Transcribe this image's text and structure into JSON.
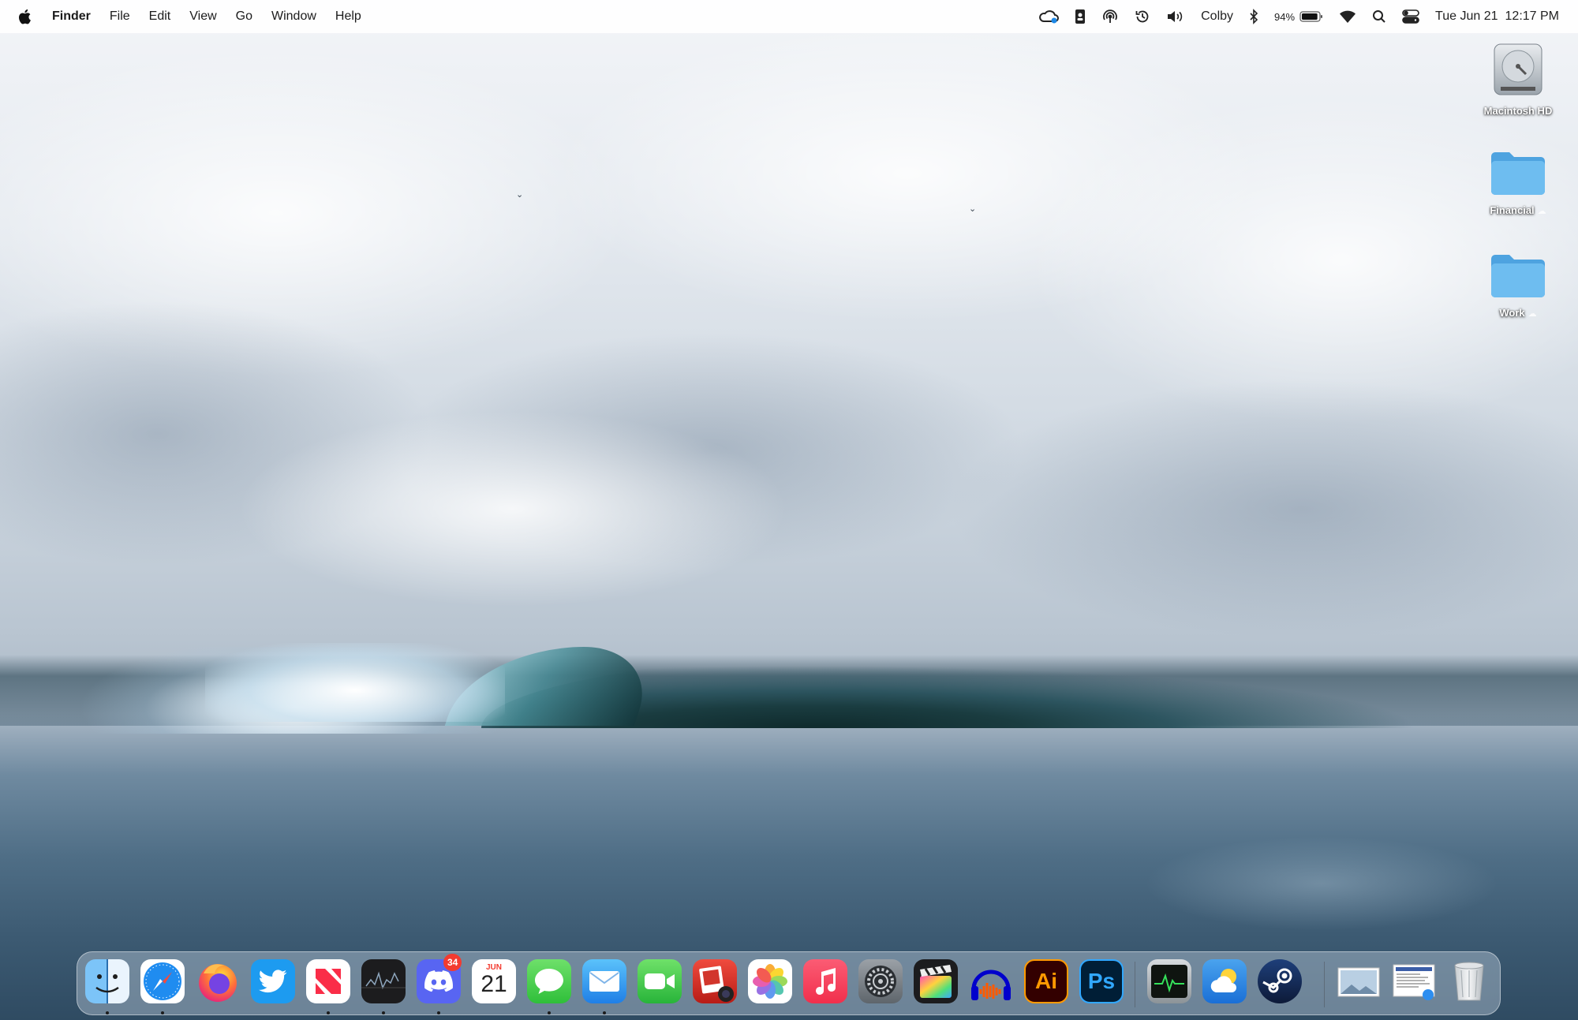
{
  "menubar": {
    "app_name": "Finder",
    "menus": [
      "File",
      "Edit",
      "View",
      "Go",
      "Window",
      "Help"
    ],
    "status": {
      "user_name": "Colby",
      "battery_percent": "94%",
      "battery_level": 0.94,
      "date": "Tue Jun 21",
      "time": "12:17 PM"
    }
  },
  "desktop": {
    "icons": [
      {
        "label": "Macintosh HD",
        "icon": "hard-drive-icon"
      },
      {
        "label": "Financial",
        "icon": "folder-icon"
      },
      {
        "label": "Work",
        "icon": "folder-icon"
      }
    ]
  },
  "dock": {
    "apps": [
      {
        "name": "Finder",
        "running": true
      },
      {
        "name": "Safari",
        "running": true
      },
      {
        "name": "Firefox",
        "running": false
      },
      {
        "name": "Twitter",
        "running": false
      },
      {
        "name": "News",
        "running": true
      },
      {
        "name": "Stocks",
        "running": true
      },
      {
        "name": "Discord",
        "running": true,
        "badge": "34"
      },
      {
        "name": "Calendar",
        "running": false,
        "month": "JUN",
        "day": "21"
      },
      {
        "name": "Messages",
        "running": true
      },
      {
        "name": "Mail",
        "running": true
      },
      {
        "name": "FaceTime",
        "running": false
      },
      {
        "name": "Photo Booth",
        "running": false
      },
      {
        "name": "Photos",
        "running": false
      },
      {
        "name": "Music",
        "running": false
      },
      {
        "name": "System Preferences",
        "running": false
      },
      {
        "name": "Final Cut Pro",
        "running": false
      },
      {
        "name": "Audacity",
        "running": false
      },
      {
        "name": "Adobe Illustrator",
        "running": false,
        "text": "Ai"
      },
      {
        "name": "Adobe Photoshop",
        "running": false,
        "text": "Ps"
      },
      {
        "name": "Activity Monitor",
        "running": false
      },
      {
        "name": "Weather",
        "running": false
      },
      {
        "name": "Steam",
        "running": false
      },
      {
        "name": "Downloads Stack",
        "running": false
      },
      {
        "name": "Documents Stack",
        "running": false
      },
      {
        "name": "Trash",
        "running": false
      }
    ]
  },
  "colors": {
    "accent_blue": "#1e88e5",
    "badge_red": "#f33b30",
    "folder_blue": "#63b3ea"
  }
}
